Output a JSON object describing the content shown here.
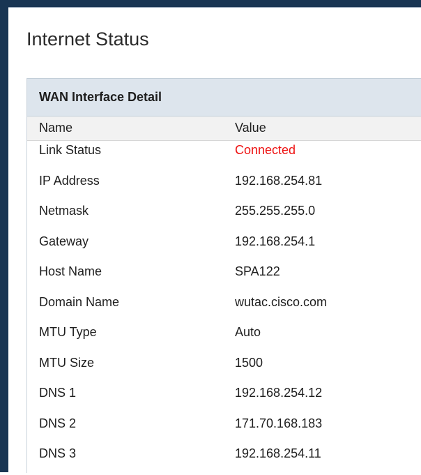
{
  "page": {
    "title": "Internet Status"
  },
  "section": {
    "title": "WAN Interface Detail"
  },
  "table": {
    "columns": [
      "Name",
      "Value"
    ],
    "rows": [
      {
        "name": "Link Status",
        "value": "Connected"
      },
      {
        "name": "IP Address",
        "value": "192.168.254.81"
      },
      {
        "name": "Netmask",
        "value": "255.255.255.0"
      },
      {
        "name": "Gateway",
        "value": "192.168.254.1"
      },
      {
        "name": "Host Name",
        "value": "SPA122"
      },
      {
        "name": "Domain Name",
        "value": "wutac.cisco.com"
      },
      {
        "name": "MTU Type",
        "value": "Auto"
      },
      {
        "name": "MTU Size",
        "value": "1500"
      },
      {
        "name": "DNS 1",
        "value": "192.168.254.12"
      },
      {
        "name": "DNS 2",
        "value": "171.70.168.183"
      },
      {
        "name": "DNS 3",
        "value": "192.168.254.11"
      }
    ]
  },
  "colors": {
    "frame": "#193553",
    "section_header_bg": "#dde5ed",
    "column_header_bg": "#f2f2f2",
    "status_connected": "#ee1111"
  }
}
